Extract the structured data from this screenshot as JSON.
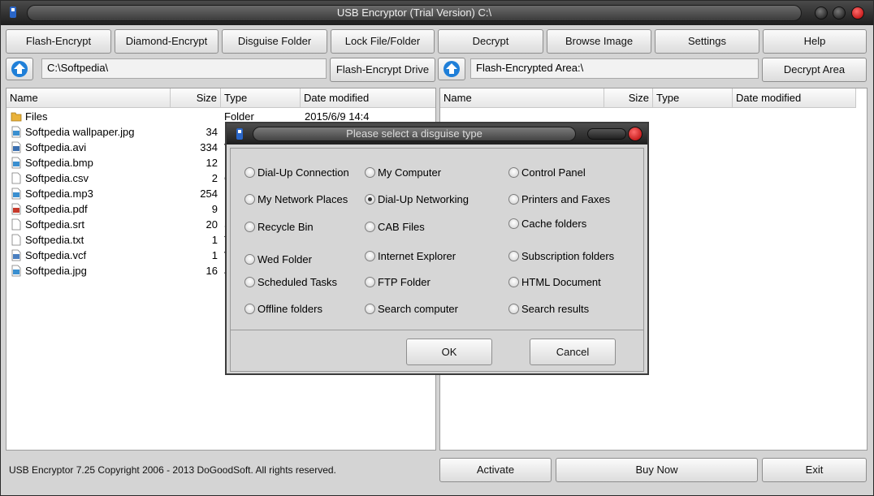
{
  "window": {
    "title": "USB Encryptor (Trial Version) C:\\"
  },
  "toolbar": [
    {
      "label": "Flash-Encrypt"
    },
    {
      "label": "Diamond-Encrypt"
    },
    {
      "label": "Disguise Folder"
    },
    {
      "label": "Lock File/Folder"
    },
    {
      "label": "Decrypt"
    },
    {
      "label": "Browse Image"
    },
    {
      "label": "Settings"
    },
    {
      "label": "Help"
    }
  ],
  "left": {
    "path": "C:\\Softpedia\\",
    "action_label": "Flash-Encrypt Drive",
    "columns": {
      "name": "Name",
      "size": "Size",
      "type": "Type",
      "date": "Date modified"
    },
    "rows": [
      {
        "name": "Files",
        "size": "",
        "type": "Folder",
        "date": "2015/6/9 14:4",
        "icon": "folder-icon"
      },
      {
        "name": "Softpedia wallpaper.jpg",
        "size": "34",
        "type": "",
        "date": "",
        "icon": "image-file-icon"
      },
      {
        "name": "Softpedia.avi",
        "size": "334",
        "type": "V",
        "date": "",
        "icon": "video-file-icon"
      },
      {
        "name": "Softpedia.bmp",
        "size": "12",
        "type": "B",
        "date": "",
        "icon": "image-file-icon"
      },
      {
        "name": "Softpedia.csv",
        "size": "2",
        "type": "C",
        "date": "",
        "icon": "blank-file-icon"
      },
      {
        "name": "Softpedia.mp3",
        "size": "254",
        "type": "",
        "date": "",
        "icon": "audio-file-icon"
      },
      {
        "name": "Softpedia.pdf",
        "size": "9",
        "type": "F",
        "date": "",
        "icon": "pdf-file-icon"
      },
      {
        "name": "Softpedia.srt",
        "size": "20",
        "type": "S",
        "date": "",
        "icon": "blank-file-icon"
      },
      {
        "name": "Softpedia.txt",
        "size": "1",
        "type": "T",
        "date": "",
        "icon": "text-file-icon"
      },
      {
        "name": "Softpedia.vcf",
        "size": "1",
        "type": "V",
        "date": "",
        "icon": "vcard-file-icon"
      },
      {
        "name": "Softpedia.jpg",
        "size": "16",
        "type": "J",
        "date": "",
        "icon": "image-file-icon"
      }
    ]
  },
  "right": {
    "path": "Flash-Encrypted Area:\\",
    "action_label": "Decrypt Area",
    "columns": {
      "name": "Name",
      "size": "Size",
      "type": "Type",
      "date": "Date modified"
    }
  },
  "footer": {
    "copyright": "USB Encryptor 7.25 Copyright 2006 - 2013 DoGoodSoft. All rights reserved.",
    "activate": "Activate",
    "buy": "Buy Now",
    "exit": "Exit"
  },
  "dialog": {
    "title": "Please select a disguise type",
    "selected": "Dial-Up Networking",
    "options": [
      "Dial-Up Connection",
      "My Computer",
      "Control Panel",
      "My Network Places",
      "Dial-Up Networking",
      "Printers and Faxes",
      "Recycle Bin",
      "CAB Files",
      "Cache folders",
      "Wed Folder",
      "Internet Explorer",
      "Subscription folders",
      "Scheduled Tasks",
      "FTP Folder",
      "HTML Document",
      "Offline folders",
      "Search computer",
      "Search results"
    ],
    "ok": "OK",
    "cancel": "Cancel"
  },
  "colors": {
    "accent_blue": "#1f7fd8",
    "close_red": "#d81818",
    "title_dark": "#1e1e1e"
  }
}
